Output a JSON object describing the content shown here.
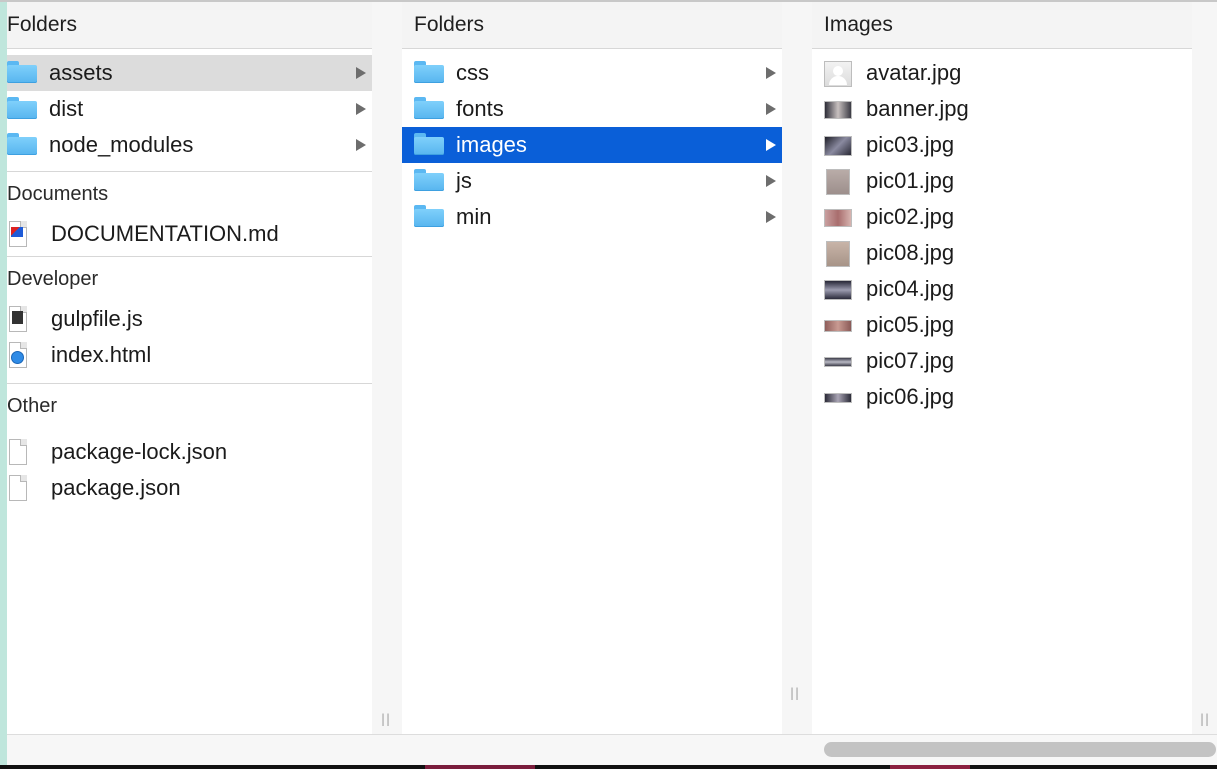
{
  "col1": {
    "header": "Folders",
    "folders": [
      {
        "label": "assets"
      },
      {
        "label": "dist"
      },
      {
        "label": "node_modules"
      }
    ],
    "documents_header": "Documents",
    "documents": [
      {
        "label": "DOCUMENTATION.md",
        "icon": "markdown-file-icon"
      }
    ],
    "developer_header": "Developer",
    "developer": [
      {
        "label": "gulpfile.js",
        "icon": "js-file-icon"
      },
      {
        "label": "index.html",
        "icon": "html-file-icon"
      }
    ],
    "other_header": "Other",
    "other": [
      {
        "label": "package-lock.json",
        "icon": "generic-file-icon"
      },
      {
        "label": "package.json",
        "icon": "generic-file-icon"
      }
    ]
  },
  "col2": {
    "header": "Folders",
    "folders": [
      {
        "label": "css"
      },
      {
        "label": "fonts"
      },
      {
        "label": "images"
      },
      {
        "label": "js"
      },
      {
        "label": "min"
      }
    ]
  },
  "col3": {
    "header": "Images",
    "images": [
      {
        "label": "avatar.jpg"
      },
      {
        "label": "banner.jpg"
      },
      {
        "label": "pic03.jpg"
      },
      {
        "label": "pic01.jpg"
      },
      {
        "label": "pic02.jpg"
      },
      {
        "label": "pic08.jpg"
      },
      {
        "label": "pic04.jpg"
      },
      {
        "label": "pic05.jpg"
      },
      {
        "label": "pic07.jpg"
      },
      {
        "label": "pic06.jpg"
      }
    ]
  },
  "colors": {
    "selection_blue": "#0a5fd8",
    "selection_gray": "#dcdcdc",
    "folder_blue": "#6fc6f8"
  }
}
